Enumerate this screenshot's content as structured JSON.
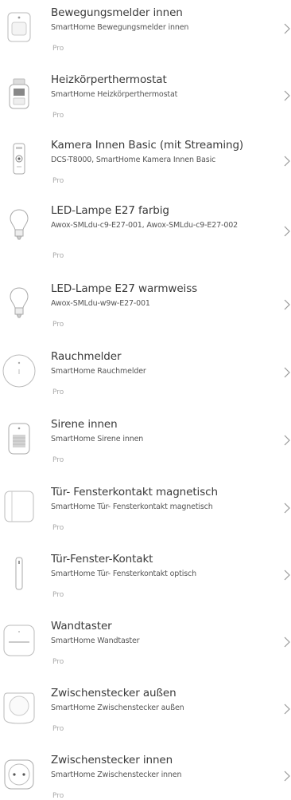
{
  "devices": [
    {
      "title": "Bewegungsmelder innen",
      "subtitle": "SmartHome Bewegungsmelder innen",
      "badge": "Pro",
      "icon": "motion-sensor"
    },
    {
      "title": "Heizkörperthermostat",
      "subtitle": "SmartHome Heizkörperthermostat",
      "badge": "Pro",
      "icon": "thermostat"
    },
    {
      "title": "Kamera Innen Basic (mit Streaming)",
      "subtitle": "DCS-T8000, SmartHome Kamera Innen Basic",
      "badge": "Pro",
      "icon": "camera"
    },
    {
      "title": "LED-Lampe E27 farbig",
      "subtitle": "Awox-SMLdu-c9-E27-001, Awox-SMLdu-c9-E27-002",
      "badge": "Pro",
      "icon": "bulb"
    },
    {
      "title": "LED-Lampe E27 warmweiss",
      "subtitle": "Awox-SMLdu-w9w-E27-001",
      "badge": "Pro",
      "icon": "bulb"
    },
    {
      "title": "Rauchmelder",
      "subtitle": "SmartHome Rauchmelder",
      "badge": "Pro",
      "icon": "smoke-detector"
    },
    {
      "title": "Sirene innen",
      "subtitle": "SmartHome Sirene innen",
      "badge": "Pro",
      "icon": "siren"
    },
    {
      "title": "Tür- Fensterkontakt magnetisch",
      "subtitle": "SmartHome Tür- Fensterkontakt magnetisch",
      "badge": "Pro",
      "icon": "magnetic-contact"
    },
    {
      "title": "Tür-Fenster-Kontakt",
      "subtitle": "SmartHome Tür- Fensterkontakt optisch",
      "badge": "Pro",
      "icon": "optical-contact"
    },
    {
      "title": "Wandtaster",
      "subtitle": "SmartHome Wandtaster",
      "badge": "Pro",
      "icon": "wall-switch"
    },
    {
      "title": "Zwischenstecker außen",
      "subtitle": "SmartHome Zwischenstecker außen",
      "badge": "Pro",
      "icon": "plug-outdoor"
    },
    {
      "title": "Zwischenstecker innen",
      "subtitle": "SmartHome Zwischenstecker innen",
      "badge": "Pro",
      "icon": "plug-indoor"
    }
  ]
}
